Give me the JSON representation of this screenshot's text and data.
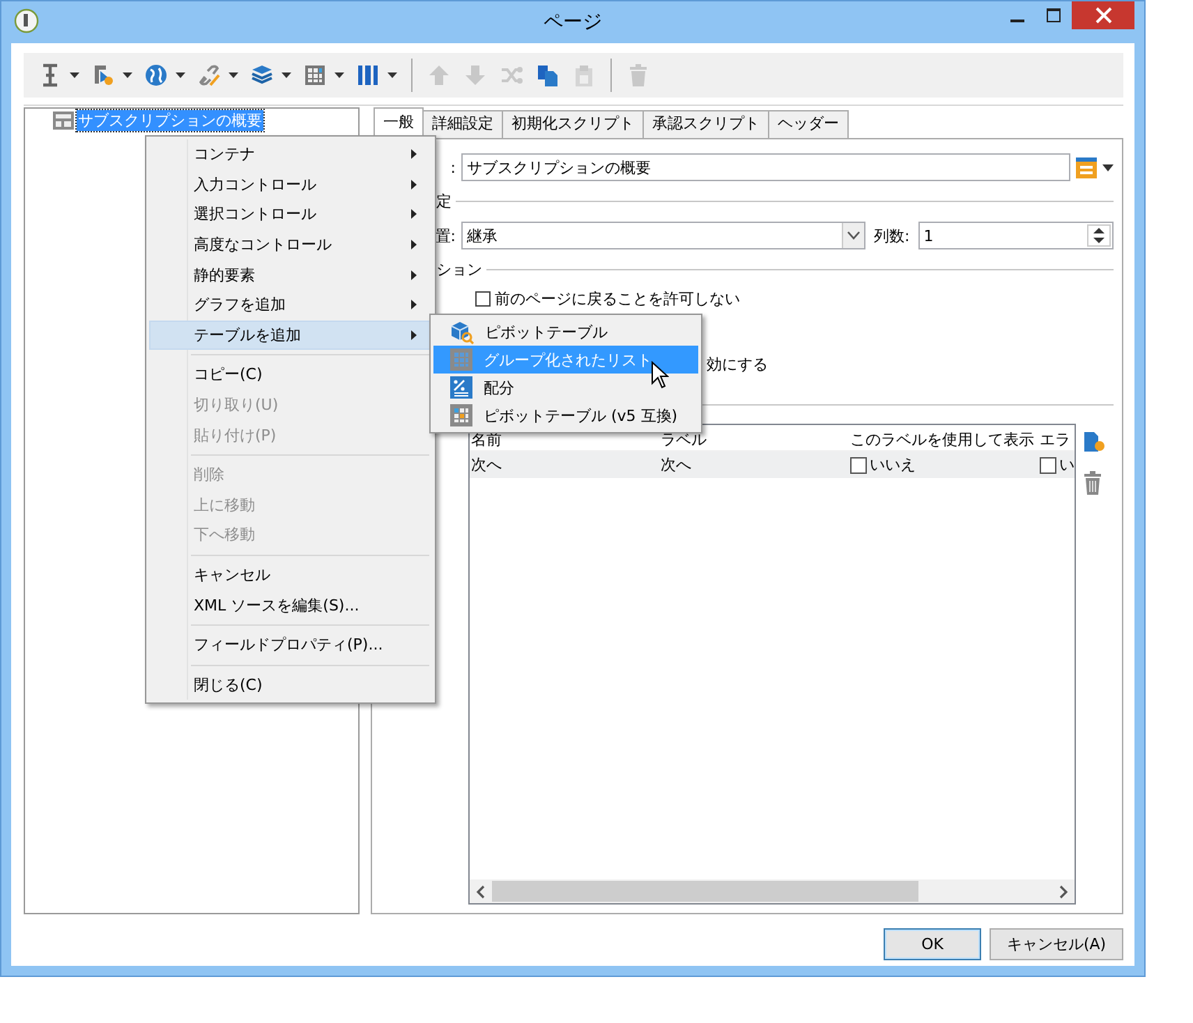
{
  "window": {
    "title": "ページ"
  },
  "toolbar": [
    {
      "kind": "dropdown",
      "disabled": false
    },
    {
      "kind": "dropdown",
      "disabled": false
    },
    {
      "kind": "dropdown",
      "disabled": false
    },
    {
      "kind": "dropdown",
      "disabled": false
    },
    {
      "kind": "dropdown",
      "disabled": false
    },
    {
      "kind": "dropdown",
      "disabled": false
    },
    {
      "kind": "dropdown",
      "disabled": false
    },
    {
      "kind": "separator"
    },
    {
      "kind": "button",
      "disabled": true
    },
    {
      "kind": "button",
      "disabled": true
    },
    {
      "kind": "button",
      "disabled": true
    },
    {
      "kind": "button",
      "disabled": false
    },
    {
      "kind": "button",
      "disabled": true
    },
    {
      "kind": "separator"
    },
    {
      "kind": "button",
      "disabled": true
    }
  ],
  "tree": {
    "items": [
      {
        "label": "サブスクリプションの概要",
        "selected": true
      }
    ]
  },
  "tabs": [
    {
      "label": "一般",
      "selected": true
    },
    {
      "label": "詳細設定",
      "selected": false
    },
    {
      "label": "初期化スクリプト",
      "selected": false
    },
    {
      "label": "承認スクリプト",
      "selected": false
    },
    {
      "label": "ヘッダー",
      "selected": false
    }
  ],
  "general": {
    "name_label": ":",
    "name_value": "サブスクリプションの概要",
    "layout_section": "定",
    "position_label": "置:",
    "position_value": "継承",
    "columns_label": "列数:",
    "columns_value": "1",
    "navigation_section": "ション",
    "checkboxes": [
      {
        "label": "前のページに戻ることを許可しない",
        "checked": false
      }
    ],
    "option_fragment": "効にする"
  },
  "table": {
    "columns": [
      "名前",
      "ラベル",
      "このラベルを使用して表示",
      "エラ"
    ],
    "rows": [
      [
        {
          "kind": "text",
          "text": "次へ"
        },
        {
          "kind": "text",
          "text": "次へ"
        },
        {
          "kind": "checkbox",
          "text": "いいえ",
          "checked": false
        },
        {
          "kind": "checkbox",
          "text": "い",
          "checked": false
        }
      ]
    ]
  },
  "context_menu": {
    "items": [
      {
        "kind": "item",
        "label": "コンテナ",
        "submenu": true,
        "selected": false,
        "disabled": false
      },
      {
        "kind": "item",
        "label": "入力コントロール",
        "submenu": true,
        "selected": false,
        "disabled": false
      },
      {
        "kind": "item",
        "label": "選択コントロール",
        "submenu": true,
        "selected": false,
        "disabled": false
      },
      {
        "kind": "item",
        "label": "高度なコントロール",
        "submenu": true,
        "selected": false,
        "disabled": false
      },
      {
        "kind": "item",
        "label": "静的要素",
        "submenu": true,
        "selected": false,
        "disabled": false
      },
      {
        "kind": "item",
        "label": "グラフを追加",
        "submenu": true,
        "selected": false,
        "disabled": false
      },
      {
        "kind": "item",
        "label": "テーブルを追加",
        "submenu": true,
        "selected": true,
        "disabled": false
      },
      {
        "kind": "separator"
      },
      {
        "kind": "item",
        "label": "コピー(C)",
        "submenu": false,
        "selected": false,
        "disabled": false
      },
      {
        "kind": "item",
        "label": "切り取り(U)",
        "submenu": false,
        "selected": false,
        "disabled": true
      },
      {
        "kind": "item",
        "label": "貼り付け(P)",
        "submenu": false,
        "selected": false,
        "disabled": true
      },
      {
        "kind": "separator"
      },
      {
        "kind": "item",
        "label": "削除",
        "submenu": false,
        "selected": false,
        "disabled": true
      },
      {
        "kind": "item",
        "label": "上に移動",
        "submenu": false,
        "selected": false,
        "disabled": true
      },
      {
        "kind": "item",
        "label": "下へ移動",
        "submenu": false,
        "selected": false,
        "disabled": true
      },
      {
        "kind": "separator"
      },
      {
        "kind": "item",
        "label": "キャンセル",
        "submenu": false,
        "selected": false,
        "disabled": false
      },
      {
        "kind": "item",
        "label": "XML ソースを編集(S)...",
        "submenu": false,
        "selected": false,
        "disabled": false
      },
      {
        "kind": "separator"
      },
      {
        "kind": "item",
        "label": "フィールドプロパティ(P)...",
        "submenu": false,
        "selected": false,
        "disabled": false
      },
      {
        "kind": "separator"
      },
      {
        "kind": "item",
        "label": "閉じる(C)",
        "submenu": false,
        "selected": false,
        "disabled": false
      }
    ]
  },
  "submenu": {
    "items": [
      {
        "kind": "pivot",
        "label": "ピボットテーブル",
        "selected": false
      },
      {
        "kind": "grouped",
        "label": "グループ化されたリスト",
        "selected": true
      },
      {
        "kind": "distribution",
        "label": "配分",
        "selected": false
      },
      {
        "kind": "pivot-v5",
        "label": "ピボットテーブル (v5 互換)",
        "selected": false
      }
    ]
  },
  "buttons": [
    {
      "label": "OK",
      "default": true
    },
    {
      "label": "キャンセル(A)",
      "default": false
    }
  ]
}
